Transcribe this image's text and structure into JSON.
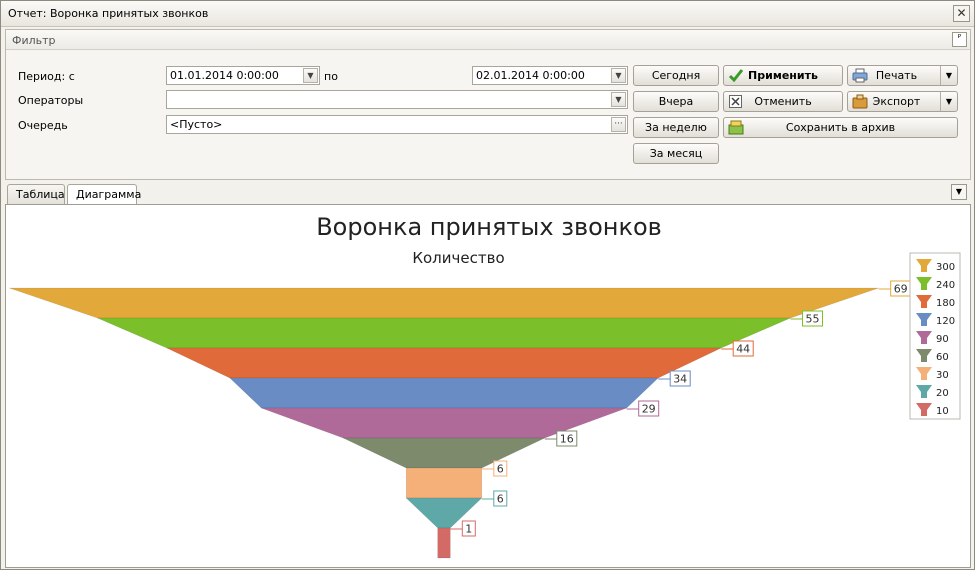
{
  "window": {
    "title": "Отчет: Воронка принятых звонков",
    "close": "✕"
  },
  "filter": {
    "title": "Фильтр",
    "pin": "ᴾ",
    "period_label": "Период: с",
    "date_from": "01.01.2014 0:00:00",
    "date_to_label": "по",
    "date_to": "02.01.2014 0:00:00",
    "operators_label": "Операторы",
    "operators_value": "",
    "queue_label": "Очередь",
    "queue_value": "<Пусто>",
    "ellipsis": "···",
    "buttons": {
      "today": "Сегодня",
      "yesterday": "Вчера",
      "week": "За неделю",
      "month": "За месяц",
      "apply": "Применить",
      "cancel": "Отменить",
      "print": "Печать",
      "export": "Экспорт",
      "archive": "Сохранить в архив"
    }
  },
  "tabs": [
    {
      "label": "Таблица",
      "active": false
    },
    {
      "label": "Диаграмма",
      "active": true
    }
  ],
  "chart_data": {
    "type": "funnel",
    "title": "Воронка принятых звонков",
    "subtitle": "Количество",
    "values": [
      69,
      55,
      44,
      34,
      29,
      16,
      6,
      6,
      1
    ],
    "colors": [
      "#e3a83a",
      "#7bbf2a",
      "#e06a3a",
      "#6a8cc4",
      "#b06a9a",
      "#7d8a6c",
      "#f5b07a",
      "#5ea9a8",
      "#d46a66"
    ],
    "legend": [
      "300",
      "240",
      "180",
      "120",
      "90",
      "60",
      "30",
      "20",
      "10"
    ],
    "legend_position": "right"
  }
}
